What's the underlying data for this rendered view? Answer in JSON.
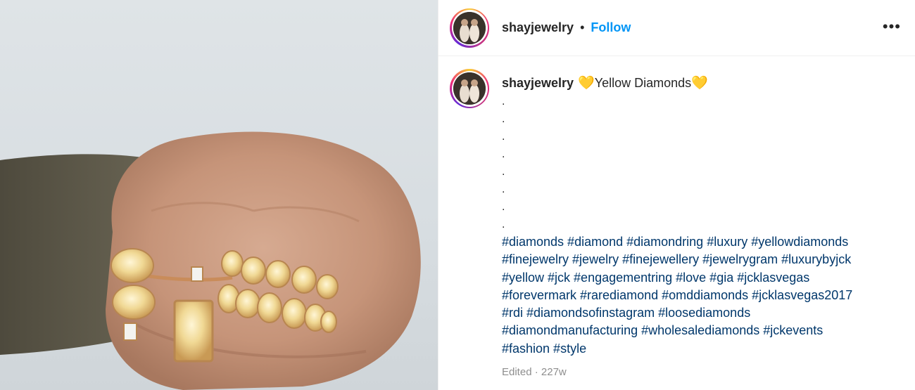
{
  "post": {
    "username": "shayjewelry",
    "separator": "•",
    "follow_label": "Follow",
    "more_label": "•••",
    "caption_title": "Yellow Diamonds",
    "heart_glyph": "💛",
    "dots": [
      ".",
      ".",
      ".",
      ".",
      ".",
      ".",
      ".",
      "."
    ],
    "hashtag_lines": [
      "#diamonds #diamond #diamondring #luxury #yellowdiamonds",
      "#finejewelry #jewelry #finejewellery #jewelrygram #luxurybyjck",
      "#yellow #jck #engagementring #love #gia #jcklasvegas",
      "#forevermark #rarediamond #omddiamonds #jcklasvegas2017",
      "#rdi #diamondsofinstagram #loosediamonds",
      "#diamondmanufacturing #wholesalediamonds #jckevents",
      "#fashion #style"
    ],
    "edited_label": "Edited",
    "age": "227w",
    "meta_separator": "·"
  },
  "colors": {
    "accent": "#0095f6",
    "hashtag": "#00376b",
    "muted": "#8e8e8e",
    "heart": "#f7c21b"
  },
  "icons": {
    "more": "more-horizontal-icon",
    "heart": "yellow-heart-icon"
  }
}
